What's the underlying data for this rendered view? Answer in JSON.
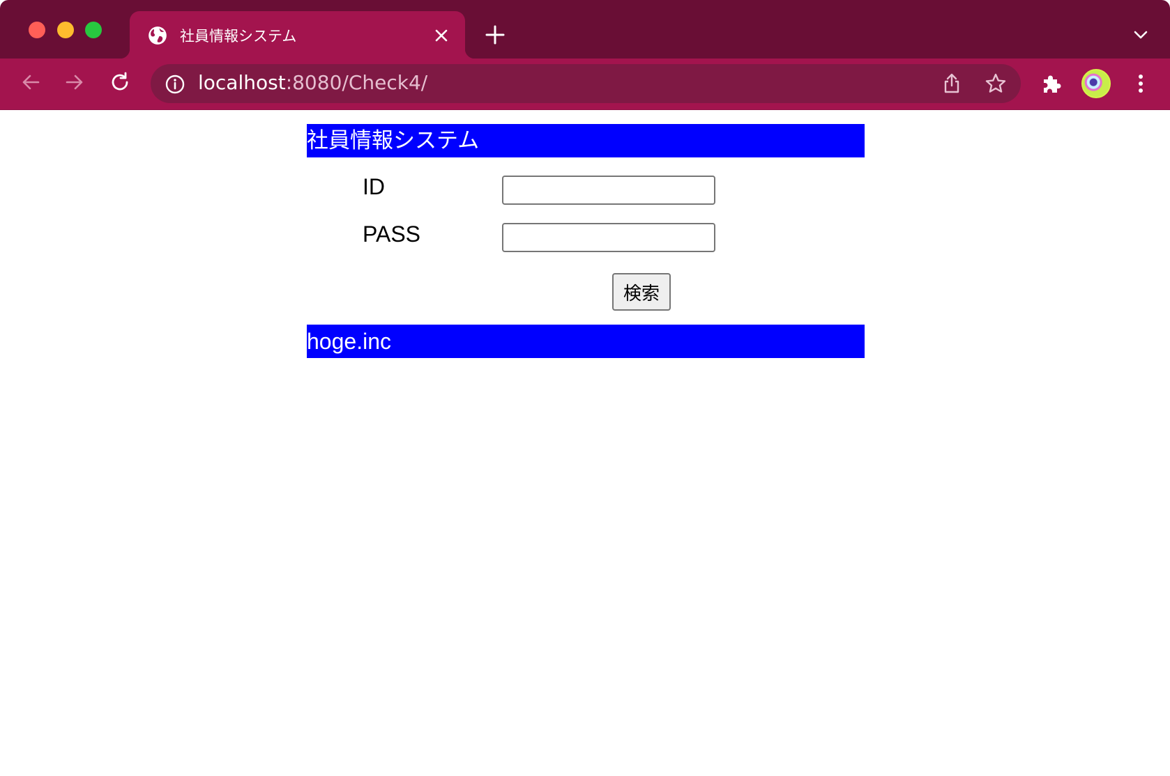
{
  "browser": {
    "tab": {
      "title": "社員情報システム",
      "favicon": "globe-icon"
    },
    "address_bar": {
      "host": "localhost",
      "rest": ":8080/Check4/"
    },
    "colors": {
      "tabstrip": "#690e35",
      "toolbar": "#a3144e",
      "omnibox": "#7f1944"
    }
  },
  "page": {
    "header": "社員情報システム",
    "form": {
      "id_label": "ID",
      "id_value": "",
      "pass_label": "PASS",
      "pass_value": "",
      "submit_label": "検索"
    },
    "footer": "hoge.inc",
    "colors": {
      "banner": "#0000ff",
      "banner_text": "#ffffff"
    }
  }
}
